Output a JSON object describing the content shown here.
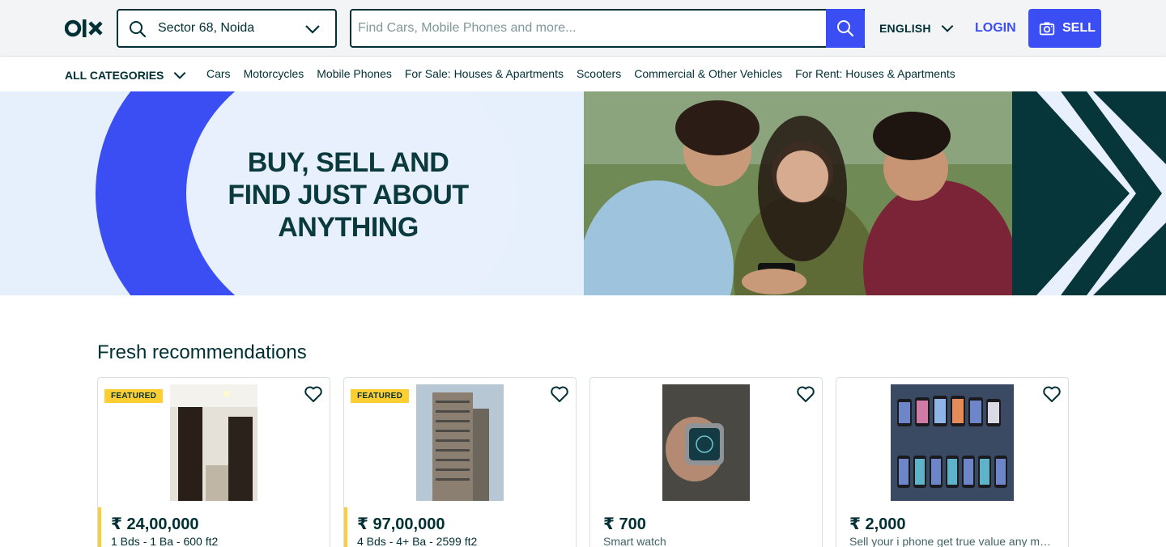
{
  "header": {
    "logo": "olx",
    "location": "Sector 68, Noida",
    "search_placeholder": "Find Cars, Mobile Phones and more...",
    "language": "ENGLISH",
    "login": "LOGIN",
    "sell": "SELL"
  },
  "categories": {
    "all_label": "ALL CATEGORIES",
    "items": [
      "Cars",
      "Motorcycles",
      "Mobile Phones",
      "For Sale: Houses & Apartments",
      "Scooters",
      "Commercial & Other Vehicles",
      "For Rent: Houses & Apartments"
    ]
  },
  "banner": {
    "line1": "BUY, SELL AND",
    "line2": "FIND JUST ABOUT",
    "line3": "ANYTHING"
  },
  "fresh": {
    "title": "Fresh recommendations",
    "cards": [
      {
        "featured": "FEATURED",
        "price": "₹ 24,00,000",
        "desc": "1 Bds - 1 Ba - 600 ft2"
      },
      {
        "featured": "FEATURED",
        "price": "₹ 97,00,000",
        "desc": "4 Bds - 4+ Ba - 2599 ft2"
      },
      {
        "featured": "",
        "price": "₹ 700",
        "desc": "Smart watch"
      },
      {
        "featured": "",
        "price": "₹ 2,000",
        "desc": "Sell your i phone get true value any mo..."
      }
    ]
  },
  "colors": {
    "accent": "#3a4ef3",
    "dark": "#002f34",
    "featured": "#ffce32"
  }
}
